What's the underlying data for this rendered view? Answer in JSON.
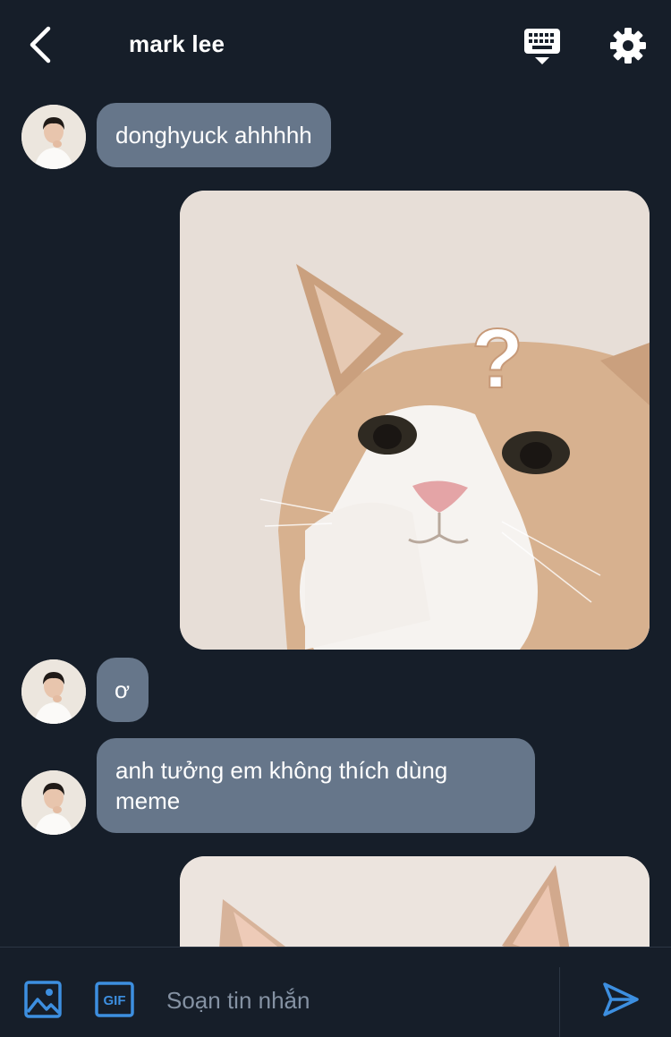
{
  "header": {
    "title": "mark lee",
    "back_icon": "chevron-left-icon",
    "keyboard_icon": "keyboard-icon",
    "settings_icon": "gear-icon"
  },
  "messages": [
    {
      "type": "text",
      "sender": "mark lee",
      "text": "donghyuck ahhhhh"
    },
    {
      "type": "image",
      "sender": "me",
      "image": "confused-cat-meme",
      "overlay_text": "?"
    },
    {
      "type": "text",
      "sender": "mark lee",
      "text": "ơ"
    },
    {
      "type": "text",
      "sender": "mark lee",
      "text": "anh tưởng em không thích dùng meme"
    },
    {
      "type": "image",
      "sender": "me",
      "image": "cat-ears-partial"
    }
  ],
  "composer": {
    "image_icon": "image-icon",
    "gif_label": "GIF",
    "placeholder": "Soạn tin nhắn",
    "send_icon": "send-icon"
  },
  "colors": {
    "background": "#161e29",
    "bubble": "#66768a",
    "accent": "#3d8fe0",
    "placeholder": "#8592a3"
  }
}
